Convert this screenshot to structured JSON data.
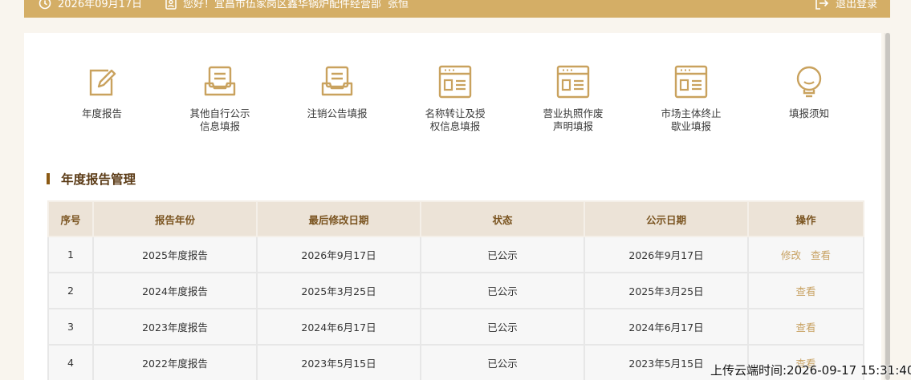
{
  "topbar": {
    "date": "2026年09月17日",
    "greeting": "您好！宜昌市伍家岗区鑫华锅炉配件经营部",
    "user": "张恒",
    "logout": "退出登录"
  },
  "quick_links": [
    {
      "label_line1": "年度报告",
      "label_line2": "",
      "icon": "edit-icon"
    },
    {
      "label_line1": "其他自行公示",
      "label_line2": "信息填报",
      "icon": "inbox-icon"
    },
    {
      "label_line1": "注销公告填报",
      "label_line2": "",
      "icon": "inbox-icon"
    },
    {
      "label_line1": "名称转让及授",
      "label_line2": "权信息填报",
      "icon": "browser-form-icon"
    },
    {
      "label_line1": "营业执照作废",
      "label_line2": "声明填报",
      "icon": "browser-form-icon"
    },
    {
      "label_line1": "市场主体终止",
      "label_line2": "歇业填报",
      "icon": "browser-form-icon"
    },
    {
      "label_line1": "填报须知",
      "label_line2": "",
      "icon": "lightbulb-icon"
    }
  ],
  "section": {
    "title": "年度报告管理"
  },
  "table": {
    "headers": [
      "序号",
      "报告年份",
      "最后修改日期",
      "状态",
      "公示日期",
      "操作"
    ],
    "rows": [
      {
        "no": "1",
        "year": "2025年度报告",
        "modified": "2026年9月17日",
        "status": "已公示",
        "published": "2026年9月17日",
        "edit": "修改",
        "view": "查看"
      },
      {
        "no": "2",
        "year": "2024年度报告",
        "modified": "2025年3月25日",
        "status": "已公示",
        "published": "2025年3月25日",
        "edit": "",
        "view": "查看"
      },
      {
        "no": "3",
        "year": "2023年度报告",
        "modified": "2024年6月17日",
        "status": "已公示",
        "published": "2024年6月17日",
        "edit": "",
        "view": "查看"
      },
      {
        "no": "4",
        "year": "2022年度报告",
        "modified": "2023年5月15日",
        "status": "已公示",
        "published": "2023年5月15日",
        "edit": "",
        "view": "查看"
      }
    ]
  },
  "watermark": "上传云端时间:2026-09-17 15:31:40",
  "colors": {
    "accent": "#d4ae66",
    "section_bar": "#8b5a14",
    "action_link": "#c8a263"
  }
}
